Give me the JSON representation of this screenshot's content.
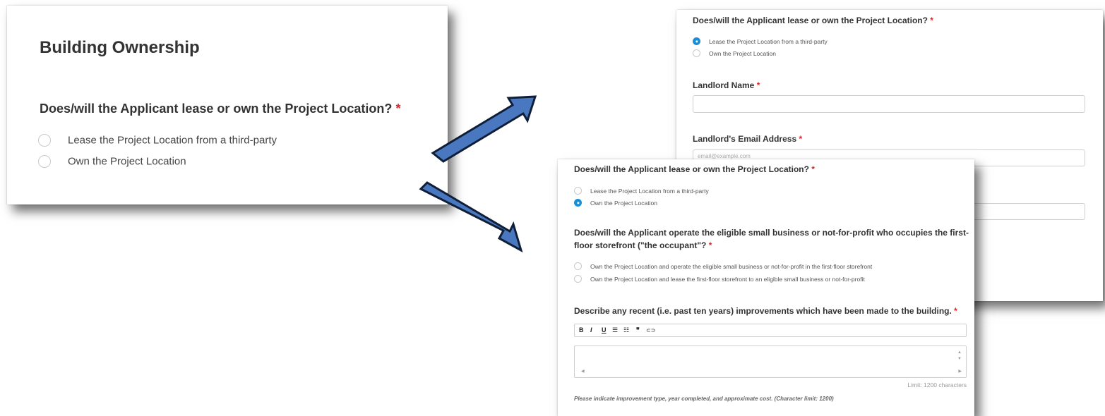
{
  "colors": {
    "arrow_fill": "#4a78c0",
    "arrow_stroke": "#0f1f38",
    "required": "#d9262c",
    "radio_checked": "#1a8fd8"
  },
  "panel1": {
    "section_title": "Building Ownership",
    "question": "Does/will the Applicant lease or own the Project Location?",
    "required_mark": "*",
    "options": [
      {
        "label": "Lease the Project Location from a third-party",
        "selected": false
      },
      {
        "label": "Own the Project Location",
        "selected": false
      }
    ]
  },
  "panel2": {
    "question": "Does/will the Applicant lease or own the Project Location?",
    "required_mark": "*",
    "options": [
      {
        "label": "Lease the Project Location from a third-party",
        "selected": true
      },
      {
        "label": "Own the Project Location",
        "selected": false
      }
    ],
    "landlord_name_label": "Landlord Name",
    "landlord_email_label": "Landlord's Email Address",
    "email_placeholder": "email@example.com"
  },
  "panel3": {
    "question": "Does/will the Applicant lease or own the Project Location?",
    "required_mark": "*",
    "options": [
      {
        "label": "Lease the Project Location from a third-party",
        "selected": false
      },
      {
        "label": "Own the Project Location",
        "selected": true
      }
    ],
    "question2_line1": "Does/will the Applicant operate the eligible small business or not-for-profit who occupies the first-",
    "question2_line2": "floor storefront (\"the occupant\"?",
    "options2": [
      {
        "label": "Own the Project Location and operate the eligible small business or not-for-profit in the first-floor storefront",
        "selected": false
      },
      {
        "label": "Own the Project Location and lease the first-floor storefront to an eligible small business or not-for-profit",
        "selected": false
      }
    ],
    "question3": "Describe any recent (i.e. past ten years) improvements which have been made to the building.",
    "toolbar": {
      "bold": "B",
      "italic": "I",
      "underline": "U",
      "bullet_list": "☰",
      "numbered_list": "☷",
      "quote": "❞",
      "link": "⊂⊃"
    },
    "limit_text": "Limit: 1200 characters",
    "help_text": "Please indicate improvement type, year completed, and approximate cost. (Character limit: 1200)"
  }
}
